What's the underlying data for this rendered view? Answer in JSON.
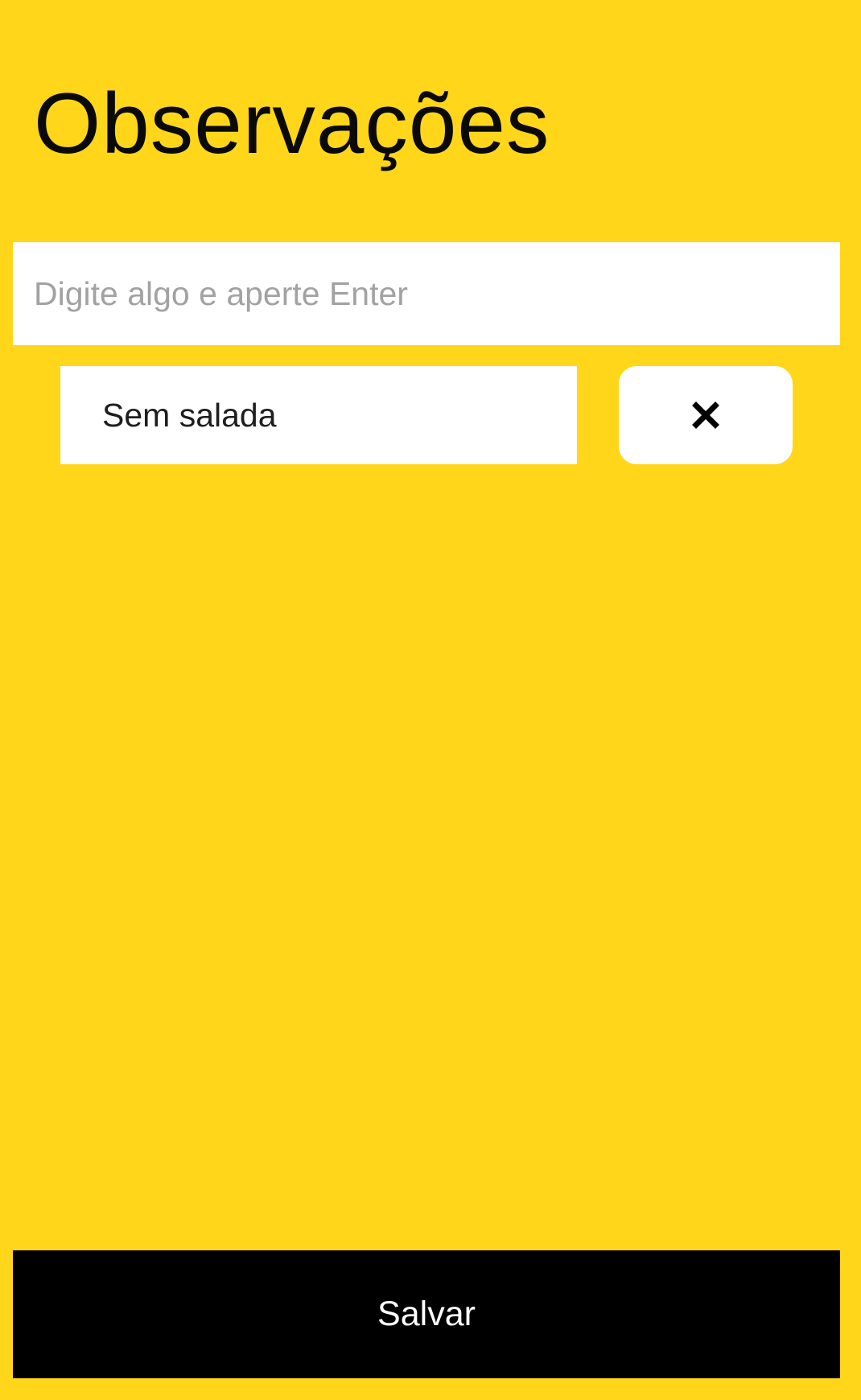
{
  "header": {
    "title": "Observações"
  },
  "input": {
    "placeholder": "Digite algo e aperte Enter",
    "value": ""
  },
  "notes": {
    "items": [
      {
        "text": "Sem salada",
        "remove_icon": "close-icon"
      }
    ]
  },
  "footer": {
    "save_label": "Salvar"
  },
  "colors": {
    "background": "#FFD619",
    "button": "#000000",
    "surface": "#FFFFFF"
  }
}
